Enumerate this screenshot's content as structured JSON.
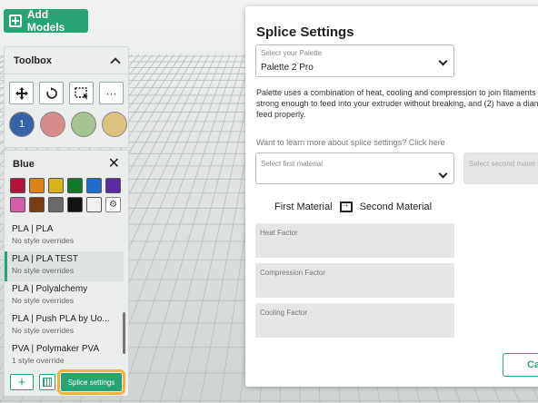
{
  "app": {
    "add_models_label": "Add Models"
  },
  "toolbox": {
    "title": "Toolbox",
    "tools": [
      "move-icon",
      "rotate-icon",
      "select-icon",
      "more-icon"
    ],
    "more_label": "···",
    "drives": [
      {
        "label": "1",
        "color": "#3463a8"
      },
      {
        "label": "",
        "color": "#d98c8a"
      },
      {
        "label": "",
        "color": "#a3c48f"
      },
      {
        "label": "",
        "color": "#dcc27f"
      }
    ]
  },
  "material_panel": {
    "title": "Blue",
    "close_label": "✕",
    "palette_colors": [
      "#b3133a",
      "#e0801a",
      "#d8b31a",
      "#0f7b2a",
      "#1b6fc8",
      "#5a2aa0",
      "#d35ea5",
      "#7a3e12",
      "#6a6a6a",
      "#111111",
      "#f0f0f0"
    ],
    "items": [
      {
        "name": "PLA | PLA",
        "sub": "No style overrides",
        "selected": false
      },
      {
        "name": "PLA | PLA TEST",
        "sub": "No style overrides",
        "selected": true
      },
      {
        "name": "PLA | Polyalchemy",
        "sub": "No style overrides",
        "selected": false
      },
      {
        "name": "PLA | Push PLA by Uo...",
        "sub": "No style overrides",
        "selected": false
      },
      {
        "name": "PVA | Polymaker PVA",
        "sub": "1 style override",
        "selected": false
      }
    ],
    "add_label": "+",
    "splice_settings_label": "Splice settings"
  },
  "dialog": {
    "title": "Splice Settings",
    "palette_field": {
      "label": "Select your Palette",
      "value": "Palette 2 Pro"
    },
    "description": "Palette uses a combination of heat, cooling and compression to join filaments strong enough to feed into your extruder without breaking, and (2) have a diam feed properly.",
    "learn_more": "Want to learn more about splice settings? Click here",
    "first_material_field": {
      "label": "Select first material"
    },
    "second_material_field": {
      "label": "Select second mater"
    },
    "first_material_label": "First Material",
    "second_material_label": "Second Material",
    "factors": [
      "Heat Factor",
      "Compression Factor",
      "Cooling Factor"
    ],
    "cancel_label": "Ca"
  }
}
